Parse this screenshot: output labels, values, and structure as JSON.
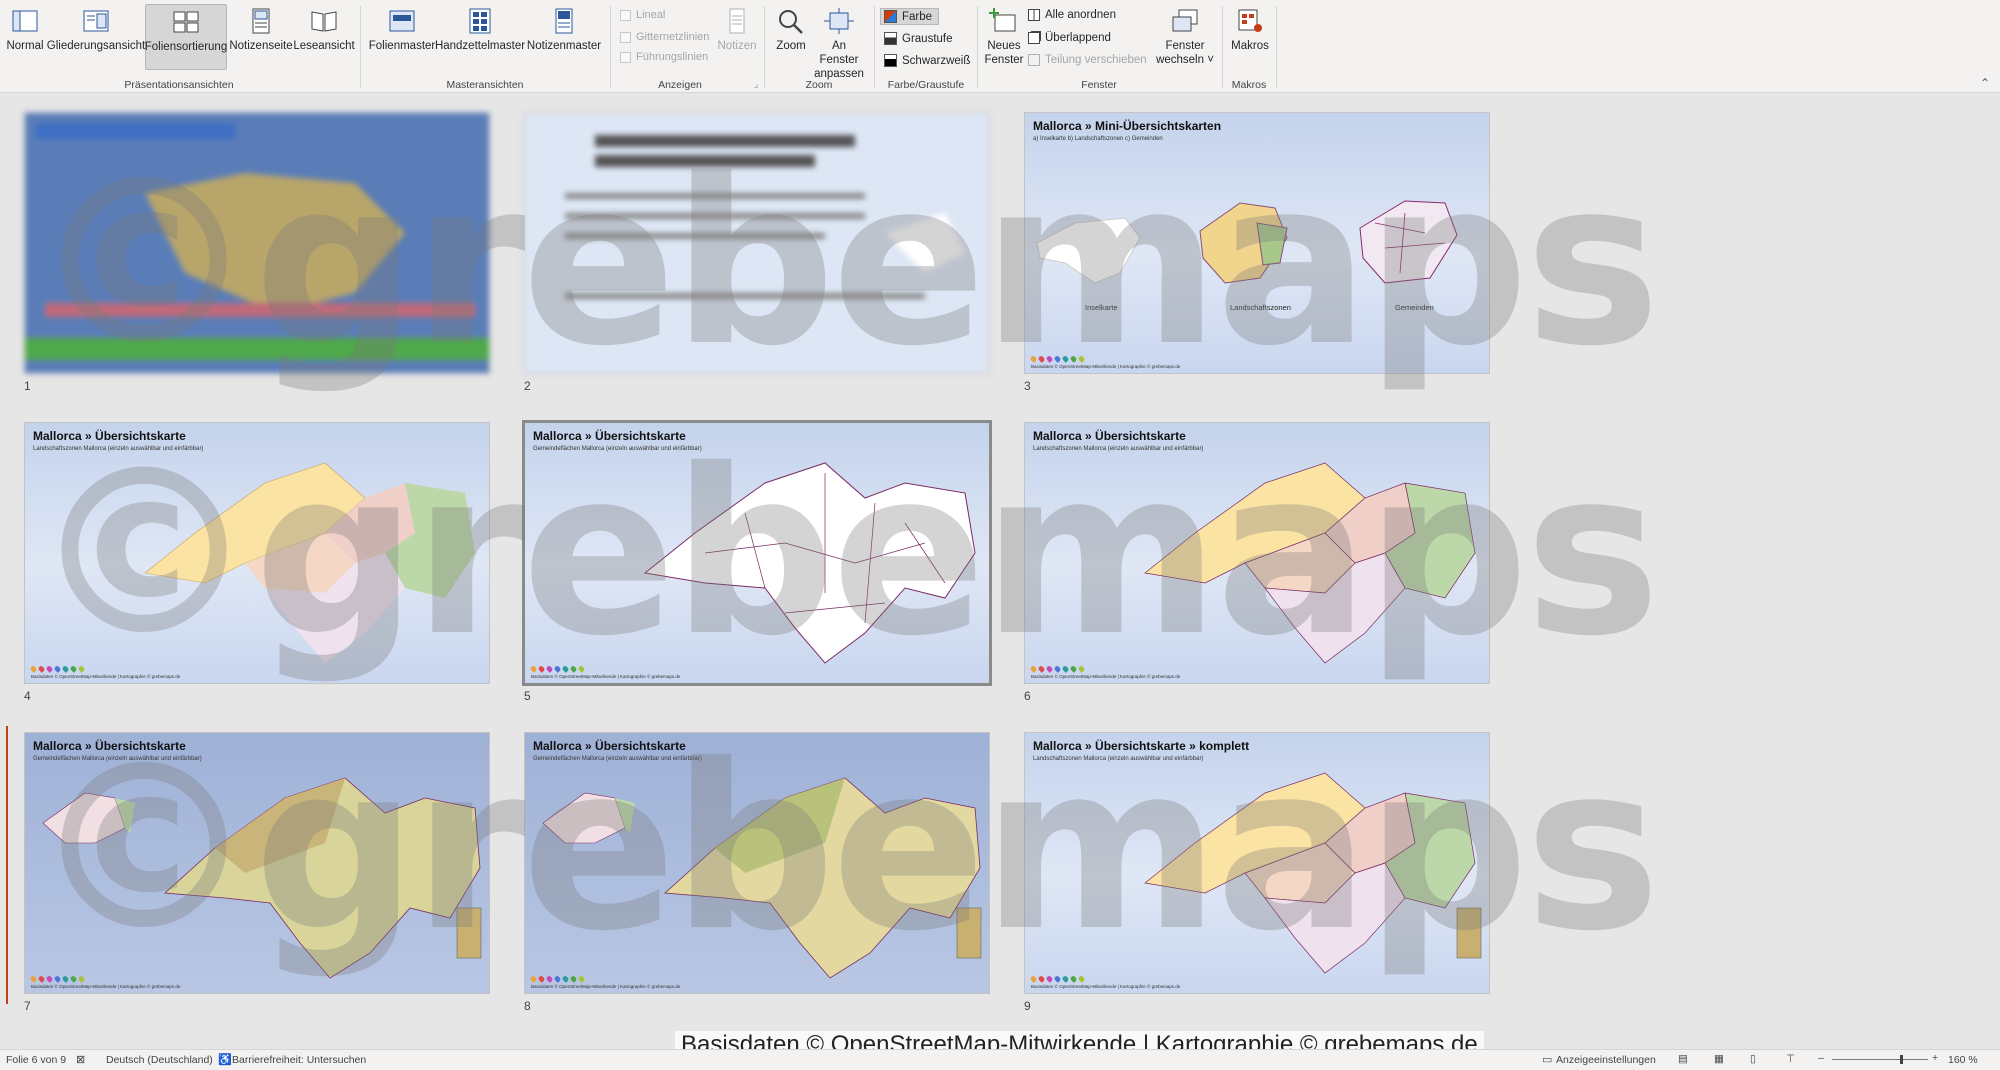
{
  "ribbon": {
    "buttons": {
      "normal": "Normal",
      "outline": "Gliederungsansicht",
      "sorter": "Foliensortierung",
      "notes_page": "Notizenseite",
      "reading": "Leseansicht",
      "slide_master": "Folienmaster",
      "handout_master": "Handzettelmaster",
      "notes_master": "Notizenmaster",
      "notes": "Notizen",
      "zoom": "Zoom",
      "fit_line1": "An Fenster",
      "fit_line2": "anpassen",
      "new_window_line1": "Neues",
      "new_window_line2": "Fenster",
      "switch_line1": "Fenster",
      "switch_line2": "wechseln ˅",
      "macros": "Makros"
    },
    "checkboxes": {
      "ruler": "Lineal",
      "grid": "Gitternetzlinien",
      "guides": "Führungslinien"
    },
    "color": {
      "color": "Farbe",
      "gray": "Graustufe",
      "bw": "Schwarzweiß"
    },
    "window": {
      "arrange": "Alle anordnen",
      "cascade": "Überlappend",
      "split": "Teilung verschieben"
    },
    "groups": {
      "presentation_views": "Präsentationsansichten",
      "master_views": "Masteransichten",
      "show": "Anzeigen",
      "zoom": "Zoom",
      "color": "Farbe/Graustufe",
      "window": "Fenster",
      "macros": "Makros"
    }
  },
  "slides": [
    {
      "num": "1",
      "title": "",
      "sub": ""
    },
    {
      "num": "2",
      "title": "",
      "sub": ""
    },
    {
      "num": "3",
      "title": "Mallorca » Mini-Übersichtskarten",
      "sub": "a) Inselkarte  b) Landschaftszonen  c) Gemeinden",
      "labels": [
        "Inselkarte",
        "Landschaftszonen",
        "Gemeinden"
      ]
    },
    {
      "num": "4",
      "title": "Mallorca » Übersichtskarte",
      "sub": "Landschaftszonen Mallorca (einzeln auswählbar und einfärbbar)"
    },
    {
      "num": "5",
      "title": "Mallorca » Übersichtskarte",
      "sub": "Gemeindeflächen Mallorca (einzeln auswählbar und einfärbbar)"
    },
    {
      "num": "6",
      "title": "Mallorca » Übersichtskarte",
      "sub": "Landschaftszonen Mallorca (einzeln auswählbar und einfärbbar)"
    },
    {
      "num": "7",
      "title": "Mallorca » Übersichtskarte",
      "sub": "Gemeindeflächen Mallorca (einzeln auswählbar und einfärbbar)"
    },
    {
      "num": "8",
      "title": "Mallorca » Übersichtskarte",
      "sub": "Gemeindeflächen Mallorca (einzeln auswählbar und einfärbbar)"
    },
    {
      "num": "9",
      "title": "Mallorca » Übersichtskarte » komplett",
      "sub": "Landschaftszonen Mallorca (einzeln auswählbar und einfärbbar)"
    }
  ],
  "slide_credit": "Basisdaten © OpenStreetMap-Mitwirkende | Kartographie © grebemaps.de",
  "watermark": "©grebemaps",
  "footer_credit": "Basisdaten © OpenStreetMap-Mitwirkende | Kartographie © grebemaps.de",
  "status": {
    "slide_count": "Folie 6 von 9",
    "language": "Deutsch (Deutschland)",
    "accessibility": "Barrierefreiheit: Untersuchen",
    "display_settings": "Anzeigeeinstellungen",
    "zoom": "160 %"
  },
  "colors": {
    "accent": "#c43e1c",
    "ribbon_bg": "#f3f2f1",
    "canvas_bg": "#e6e6e6"
  }
}
